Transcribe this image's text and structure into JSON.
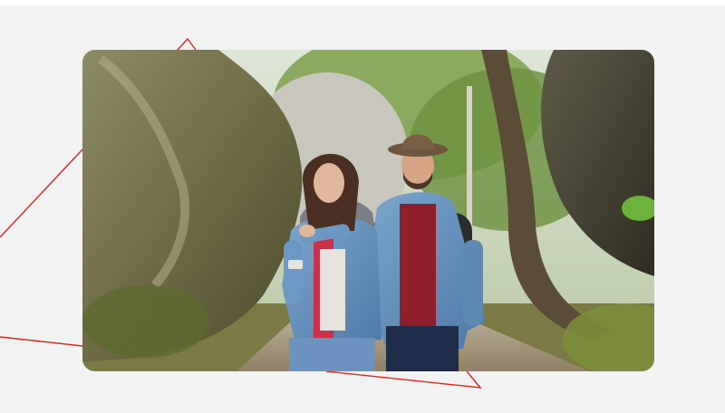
{
  "photo": {
    "subject": "hikers-on-forest-trail"
  },
  "colors": {
    "page_background": "#f2f2f2",
    "accent_line": "#e0251b"
  }
}
